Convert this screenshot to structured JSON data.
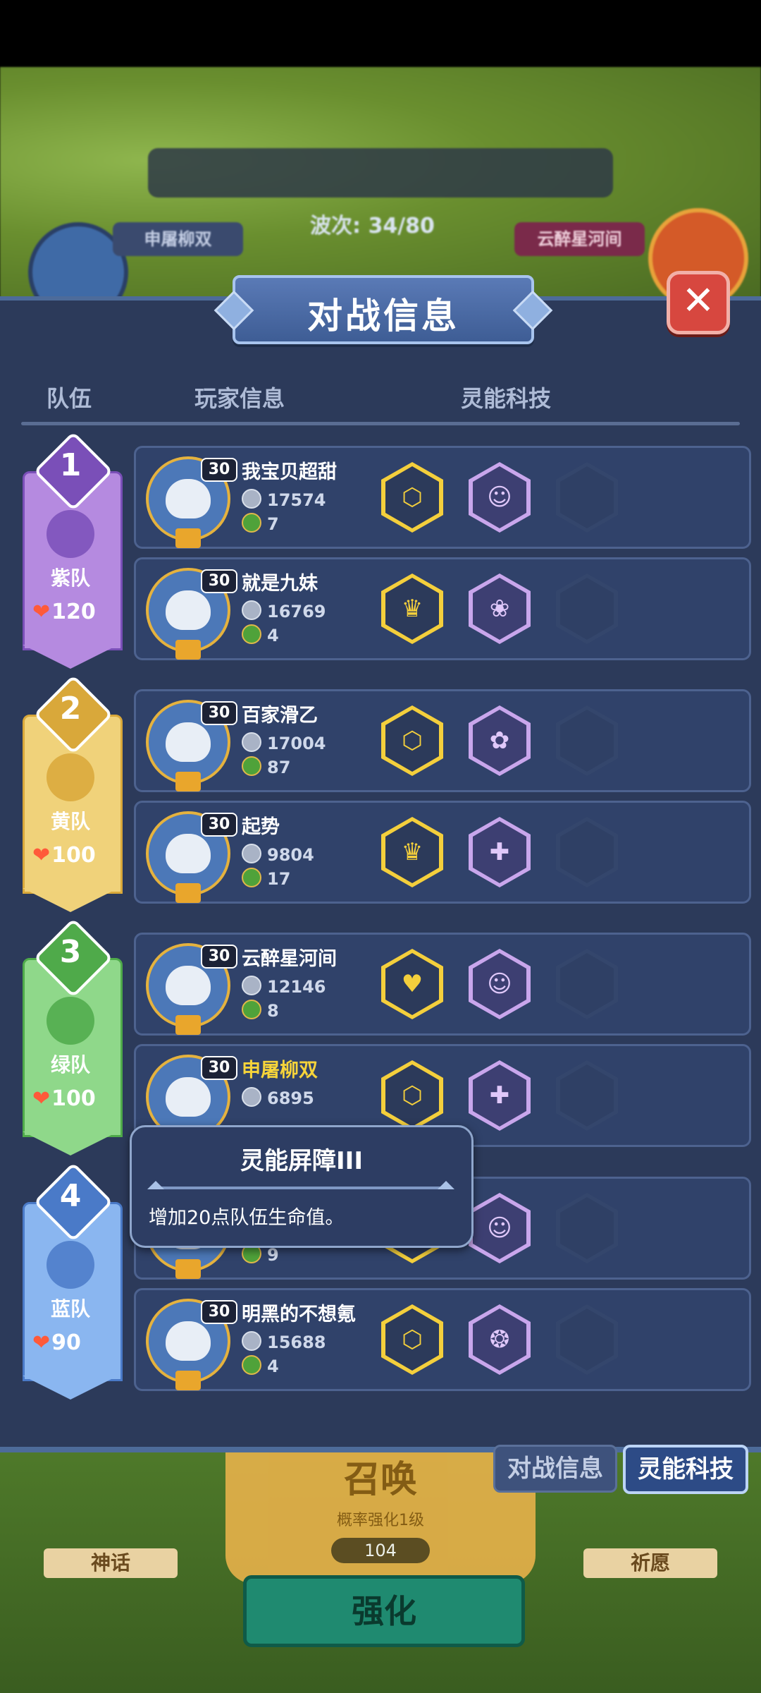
{
  "hud": {
    "wave": "波次: 34/80",
    "player_left": "申屠柳双",
    "player_right": "云醉星河间"
  },
  "panel": {
    "title": "对战信息",
    "close_glyph": "✕",
    "columns": {
      "team": "队伍",
      "player": "玩家信息",
      "tech": "灵能科技"
    }
  },
  "teams": [
    {
      "rank": "1",
      "name": "紫队",
      "hp": "120",
      "color": "#b58ae0",
      "dark": "#7a4fb8",
      "players": [
        {
          "level": "30",
          "name": "我宝贝超甜",
          "silver": "17574",
          "green": "7",
          "tech1": "⬡",
          "tech2": "☺"
        },
        {
          "level": "30",
          "name": "就是九妹",
          "silver": "16769",
          "green": "4",
          "tech1": "♛",
          "tech2": "❀"
        }
      ]
    },
    {
      "rank": "2",
      "name": "黄队",
      "hp": "100",
      "color": "#f0d27a",
      "dark": "#d9a83a",
      "players": [
        {
          "level": "30",
          "name": "百家滑乙",
          "silver": "17004",
          "green": "87",
          "tech1": "⬡",
          "tech2": "✿"
        },
        {
          "level": "30",
          "name": "起势",
          "silver": "9804",
          "green": "17",
          "tech1": "♛",
          "tech2": "✚"
        }
      ]
    },
    {
      "rank": "3",
      "name": "绿队",
      "hp": "100",
      "color": "#8fd88a",
      "dark": "#4faa4a",
      "players": [
        {
          "level": "30",
          "name": "云醉星河间",
          "silver": "12146",
          "green": "8",
          "tech1": "♥",
          "tech2": "☺"
        },
        {
          "level": "30",
          "name": "申屠柳双",
          "silver": "6895",
          "green": "",
          "tech1": "⬡",
          "tech2": "✚"
        }
      ]
    },
    {
      "rank": "4",
      "name": "蓝队",
      "hp": "90",
      "color": "#8ab6f0",
      "dark": "#4a7ac8",
      "players": [
        {
          "level": "",
          "name": "",
          "silver": "",
          "green": "9",
          "tech1": "⬡",
          "tech2": "☺"
        },
        {
          "level": "30",
          "name": "明黑的不想氪",
          "silver": "15688",
          "green": "4",
          "tech1": "⬡",
          "tech2": "❂"
        }
      ]
    }
  ],
  "tooltip": {
    "title": "灵能屏障III",
    "desc": "增加20点队伍生命值。"
  },
  "tabs": {
    "battle_info": "对战信息",
    "psi_tech": "灵能科技"
  },
  "bottom": {
    "summon": "召唤",
    "summon_sub": "概率强化1级",
    "summon_cost": "104",
    "myth": "神话",
    "pray": "祈愿",
    "upgrade": "强化"
  }
}
